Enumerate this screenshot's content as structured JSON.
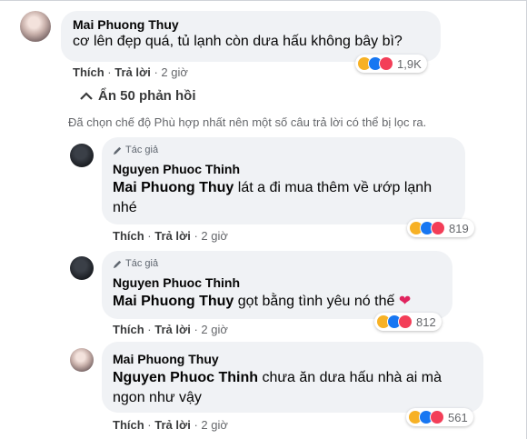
{
  "comment": {
    "author": "Mai Phuong Thuy",
    "text": "cơ lên đẹp quá, tủ lạnh còn dưa hấu không bây bì?",
    "like_label": "Thích",
    "reply_label": "Trả lời",
    "time": "2 giờ",
    "reaction_count": "1,9K"
  },
  "hide_replies": {
    "label": "Ẩn 50 phản hồi",
    "icon": "chevron-up-icon"
  },
  "filter_notice": "Đã chọn chế độ Phù hợp nhất nên một số câu trả lời có thể bị lọc ra.",
  "replies": [
    {
      "author_tag": "Tác giả",
      "author": "Nguyen Phuoc Thinh",
      "mention": "Mai Phuong Thuy",
      "text_line1": " lát a đi mua thêm về ướp lạnh",
      "text_line2": "nhé",
      "like_label": "Thích",
      "reply_label": "Trả lời",
      "time": "2 giờ",
      "reaction_count": "819"
    },
    {
      "author_tag": "Tác giả",
      "author": "Nguyen Phuoc Thinh",
      "mention": "Mai Phuong Thuy",
      "text_line1": " gọt bằng tình yêu nó thế ",
      "emoji": "❤",
      "like_label": "Thích",
      "reply_label": "Trả lời",
      "time": "2 giờ",
      "reaction_count": "812"
    },
    {
      "author": "Mai Phuong Thuy",
      "mention": "Nguyen Phuoc Thinh",
      "text_line1": " chưa ăn dưa hấu nhà ai mà",
      "text_line2": "ngon như vậy",
      "like_label": "Thích",
      "reply_label": "Trả lời",
      "time": "2 giờ",
      "reaction_count": "561"
    }
  ],
  "colors": {
    "bubble": "#f0f2f5",
    "haha": "#f7b125",
    "like": "#1877f2",
    "love": "#f33e58",
    "heart": "#e0245e"
  }
}
